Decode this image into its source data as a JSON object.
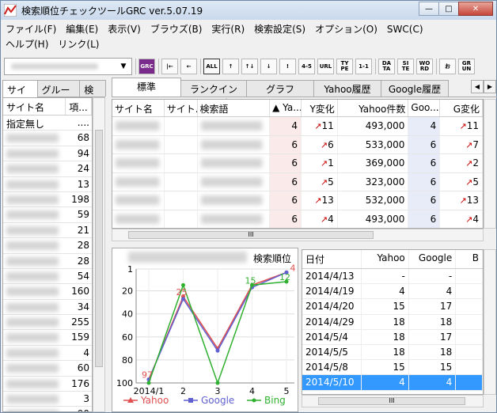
{
  "window": {
    "title": "検索順位チェックツールGRC  ver.5.07.19",
    "buttons": {
      "minimize": "—",
      "maximize": "□",
      "close": "✕"
    }
  },
  "menu": {
    "row1": [
      "ファイル(F)",
      "編集(E)",
      "表示(V)",
      "ブラウズ(B)",
      "実行(R)",
      "検索設定(S)",
      "オプション(O)",
      "SWC(C)"
    ],
    "row2": [
      "ヘルプ(H)",
      "リンク(L)"
    ]
  },
  "toolbar": {
    "combo_arrow": "▼",
    "buttons": [
      "GRC",
      "|←",
      "←",
      "ALL",
      "↑",
      "↑↓",
      "↓",
      "!",
      "4-5",
      "URL",
      "TY PE",
      "1-1",
      "DA TA",
      "SI TE",
      "WO RD",
      "お",
      "GR UN"
    ]
  },
  "left": {
    "tabs": [
      "サイト",
      "グループ",
      "検索"
    ],
    "columns": [
      "サイト名",
      "項..."
    ],
    "rows": [
      {
        "name": "指定無し",
        "num": "...."
      },
      {
        "name": "",
        "num": "68"
      },
      {
        "name": "",
        "num": "94"
      },
      {
        "name": "",
        "num": "24"
      },
      {
        "name": "",
        "num": "13"
      },
      {
        "name": "",
        "num": "198"
      },
      {
        "name": "",
        "num": "59"
      },
      {
        "name": "",
        "num": "21"
      },
      {
        "name": "",
        "num": "28"
      },
      {
        "name": "",
        "num": "28"
      },
      {
        "name": "",
        "num": "54"
      },
      {
        "name": "",
        "num": "160"
      },
      {
        "name": "",
        "num": "34"
      },
      {
        "name": "",
        "num": "255"
      },
      {
        "name": "",
        "num": "159"
      },
      {
        "name": "",
        "num": "4"
      },
      {
        "name": "",
        "num": "60"
      },
      {
        "name": "",
        "num": "176"
      },
      {
        "name": "",
        "num": "3"
      },
      {
        "name": "",
        "num": "90"
      }
    ]
  },
  "right": {
    "tabs": [
      "標準",
      "ランクインページ",
      "グラフ",
      "Yahoo履歴",
      "Google履歴"
    ],
    "tab_nav": [
      "◀",
      "▶"
    ],
    "columns": [
      "サイト名",
      "サイト...",
      "検索語",
      "▲ Ya...",
      "Y変化",
      "Yahoo件数",
      "Goo...",
      "G変化"
    ],
    "rows": [
      {
        "ya": "4",
        "yc": "11",
        "yn": "493,000",
        "go": "4",
        "gc": "11"
      },
      {
        "ya": "6",
        "yc": "6",
        "yn": "533,000",
        "go": "6",
        "gc": "7"
      },
      {
        "ya": "6",
        "yc": "1",
        "yn": "369,000",
        "go": "6",
        "gc": "2"
      },
      {
        "ya": "6",
        "yc": "5",
        "yn": "323,000",
        "go": "6",
        "gc": "5"
      },
      {
        "ya": "6",
        "yc": "13",
        "yn": "532,000",
        "go": "6",
        "gc": "13"
      },
      {
        "ya": "6",
        "yc": "4",
        "yn": "493,000",
        "go": "6",
        "gc": "4"
      }
    ],
    "scroll_thumb": "III"
  },
  "chart": {
    "ylabel": "検索順位",
    "yticks": [
      "1",
      "20",
      "40",
      "60",
      "80",
      "100"
    ],
    "xticks": [
      "2014/1",
      "2",
      "3",
      "4",
      "5"
    ],
    "annotations": [
      "97",
      "25",
      "15",
      "12",
      "4"
    ],
    "legend": [
      "Yahoo",
      "Google",
      "Bing"
    ],
    "colors": {
      "yahoo": "#e05050",
      "google": "#6060d0",
      "bing": "#30b030"
    }
  },
  "chart_data": {
    "type": "line",
    "ylabel": "検索順位",
    "ylim": [
      100,
      1
    ],
    "x": [
      "2014/1",
      "2",
      "3",
      "4",
      "5"
    ],
    "series": [
      {
        "name": "Yahoo",
        "values": [
          97,
          25,
          70,
          15,
          4
        ]
      },
      {
        "name": "Google",
        "values": [
          97,
          27,
          72,
          17,
          4
        ]
      },
      {
        "name": "Bing",
        "values": [
          100,
          15,
          100,
          15,
          12
        ]
      }
    ]
  },
  "history": {
    "columns": [
      "日付",
      "Yahoo",
      "Google",
      "B"
    ],
    "rows": [
      {
        "date": "2014/4/13",
        "y": "-",
        "g": "-"
      },
      {
        "date": "2014/4/19",
        "y": "4",
        "g": "4"
      },
      {
        "date": "2014/4/20",
        "y": "15",
        "g": "17"
      },
      {
        "date": "2014/4/29",
        "y": "18",
        "g": "18"
      },
      {
        "date": "2014/5/4",
        "y": "18",
        "g": "17"
      },
      {
        "date": "2014/5/5",
        "y": "18",
        "g": "18"
      },
      {
        "date": "2014/5/8",
        "y": "15",
        "g": "15"
      },
      {
        "date": "2014/5/10",
        "y": "4",
        "g": "4"
      }
    ],
    "scroll_thumb": "III"
  }
}
